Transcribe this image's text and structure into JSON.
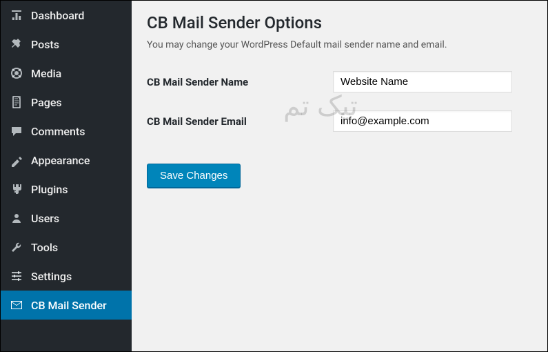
{
  "sidebar": {
    "items": [
      {
        "label": "Dashboard",
        "icon": "dashboard-icon"
      },
      {
        "label": "Posts",
        "icon": "pin-icon"
      },
      {
        "label": "Media",
        "icon": "media-icon"
      },
      {
        "label": "Pages",
        "icon": "pages-icon"
      },
      {
        "label": "Comments",
        "icon": "comments-icon"
      },
      {
        "label": "Appearance",
        "icon": "appearance-icon"
      },
      {
        "label": "Plugins",
        "icon": "plugins-icon"
      },
      {
        "label": "Users",
        "icon": "users-icon"
      },
      {
        "label": "Tools",
        "icon": "tools-icon"
      },
      {
        "label": "Settings",
        "icon": "settings-icon"
      },
      {
        "label": "CB Mail Sender",
        "icon": "mail-icon",
        "current": true
      }
    ]
  },
  "main": {
    "title": "CB Mail Sender Options",
    "description": "You may change your WordPress Default mail sender name and email.",
    "fields": {
      "name_label": "CB Mail Sender Name",
      "name_value": "Website Name",
      "email_label": "CB Mail Sender Email",
      "email_value": "info@example.com"
    },
    "save_label": "Save Changes"
  },
  "watermark": "تیک تم"
}
